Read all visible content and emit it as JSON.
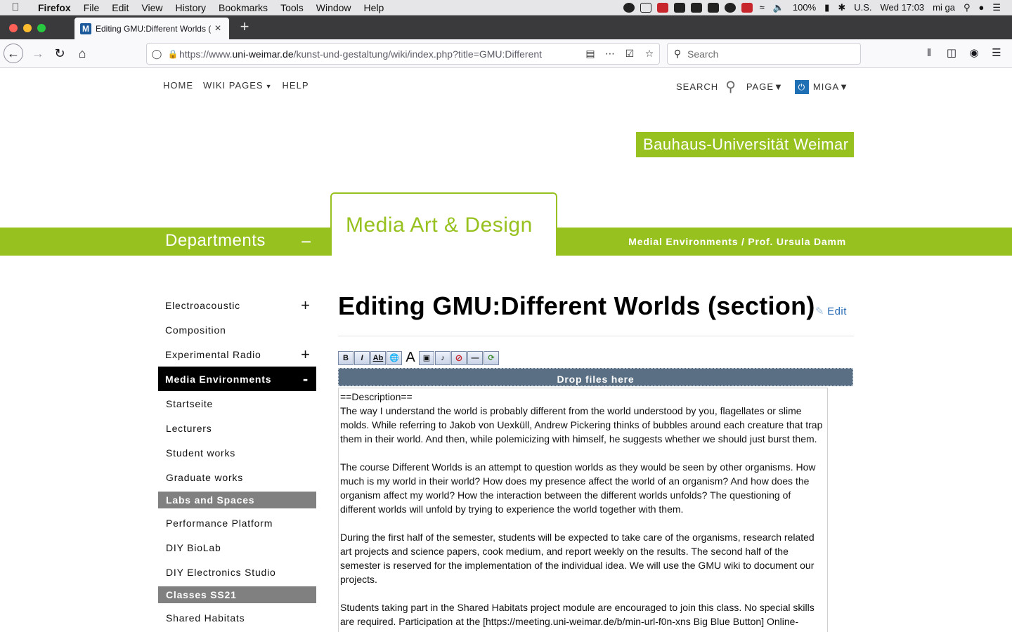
{
  "os_menubar": {
    "app_name": "Firefox",
    "menus": [
      "File",
      "Edit",
      "View",
      "History",
      "Bookmarks",
      "Tools",
      "Window",
      "Help"
    ],
    "battery": "100%",
    "input_source": "U.S.",
    "clock": "Wed 17:03",
    "user": "mi ga"
  },
  "browser": {
    "tab_title": "Editing GMU:Different Worlds (",
    "favicon_letter": "M",
    "url_prefix": "https://www.",
    "url_domain": "uni-weimar.de",
    "url_rest": "/kunst-und-gestaltung/wiki/index.php?title=GMU:Different",
    "search_placeholder": "Search"
  },
  "site_nav": {
    "home": "HOME",
    "wiki_pages": "WIKI PAGES",
    "help": "HELP",
    "search": "SEARCH",
    "page": "PAGE",
    "user": "MIGA"
  },
  "branding": {
    "university": "Bauhaus-Universität Weimar",
    "departments": "Departments",
    "departments_toggle": "−",
    "faculty": "Media Art & Design",
    "chair": "Medial Environments / Prof. Ursula Damm",
    "accent_color": "#97c11f"
  },
  "sidebar": {
    "items": [
      {
        "label": "Electroacoustic",
        "toggle": "+"
      },
      {
        "label": "Composition",
        "toggle": ""
      },
      {
        "label": "Experimental Radio",
        "toggle": "+"
      },
      {
        "label": "Media Environments",
        "toggle": "-"
      }
    ],
    "sub_items": [
      "Startseite",
      "Lecturers",
      "Student works",
      "Graduate works"
    ],
    "section_labs": "Labs and Spaces",
    "labs": [
      "Performance Platform",
      "DIY BioLab",
      "DIY Electronics Studio"
    ],
    "section_classes": "Classes SS21",
    "classes": [
      "Shared Habitats"
    ]
  },
  "main": {
    "title": "Editing GMU:Different Worlds (section)",
    "edit_label": "Edit",
    "dropzone_label": "Drop files here",
    "toolbar_icons": [
      "bold-icon",
      "italic-icon",
      "internal-link-icon",
      "external-link-icon",
      "headline-icon",
      "image-icon",
      "media-icon",
      "nowiki-icon",
      "horizontal-rule-icon",
      "signature-icon"
    ],
    "editor_lines": [
      "==Description==",
      "The way I understand the world is probably different from the world understood by you, flagellates or slime molds. While referring to Jakob von Uexküll, Andrew Pickering thinks of bubbles around each creature that trap them in their world. And then, while polemicizing with himself, he suggests whether we should just burst them.",
      "The course Different Worlds is an attempt to question worlds as they would be seen by other organisms. How much is my world in their world? How does my presence affect the world of an organism? And how does the organism affect my world? How the interaction between the different worlds unfolds? The questioning of different worlds will unfold by trying to experience the world together with them.",
      "During the first half of the semester, students will be expected to take care of the organisms, research related art projects and science papers, cook medium, and report weekly on the results. The second half of the semester is reserved for the implementation of the individual idea. We will use the GMU wiki to document our projects.",
      "Students taking part in the Shared Habitats project module are encouraged to join this class. No special skills are required. Participation at the [https://meeting.uni-weimar.de/b/min-url-f0n-xns Big Blue Button] Online-Sessions and, if possible, the DIY biolab of the university."
    ]
  }
}
